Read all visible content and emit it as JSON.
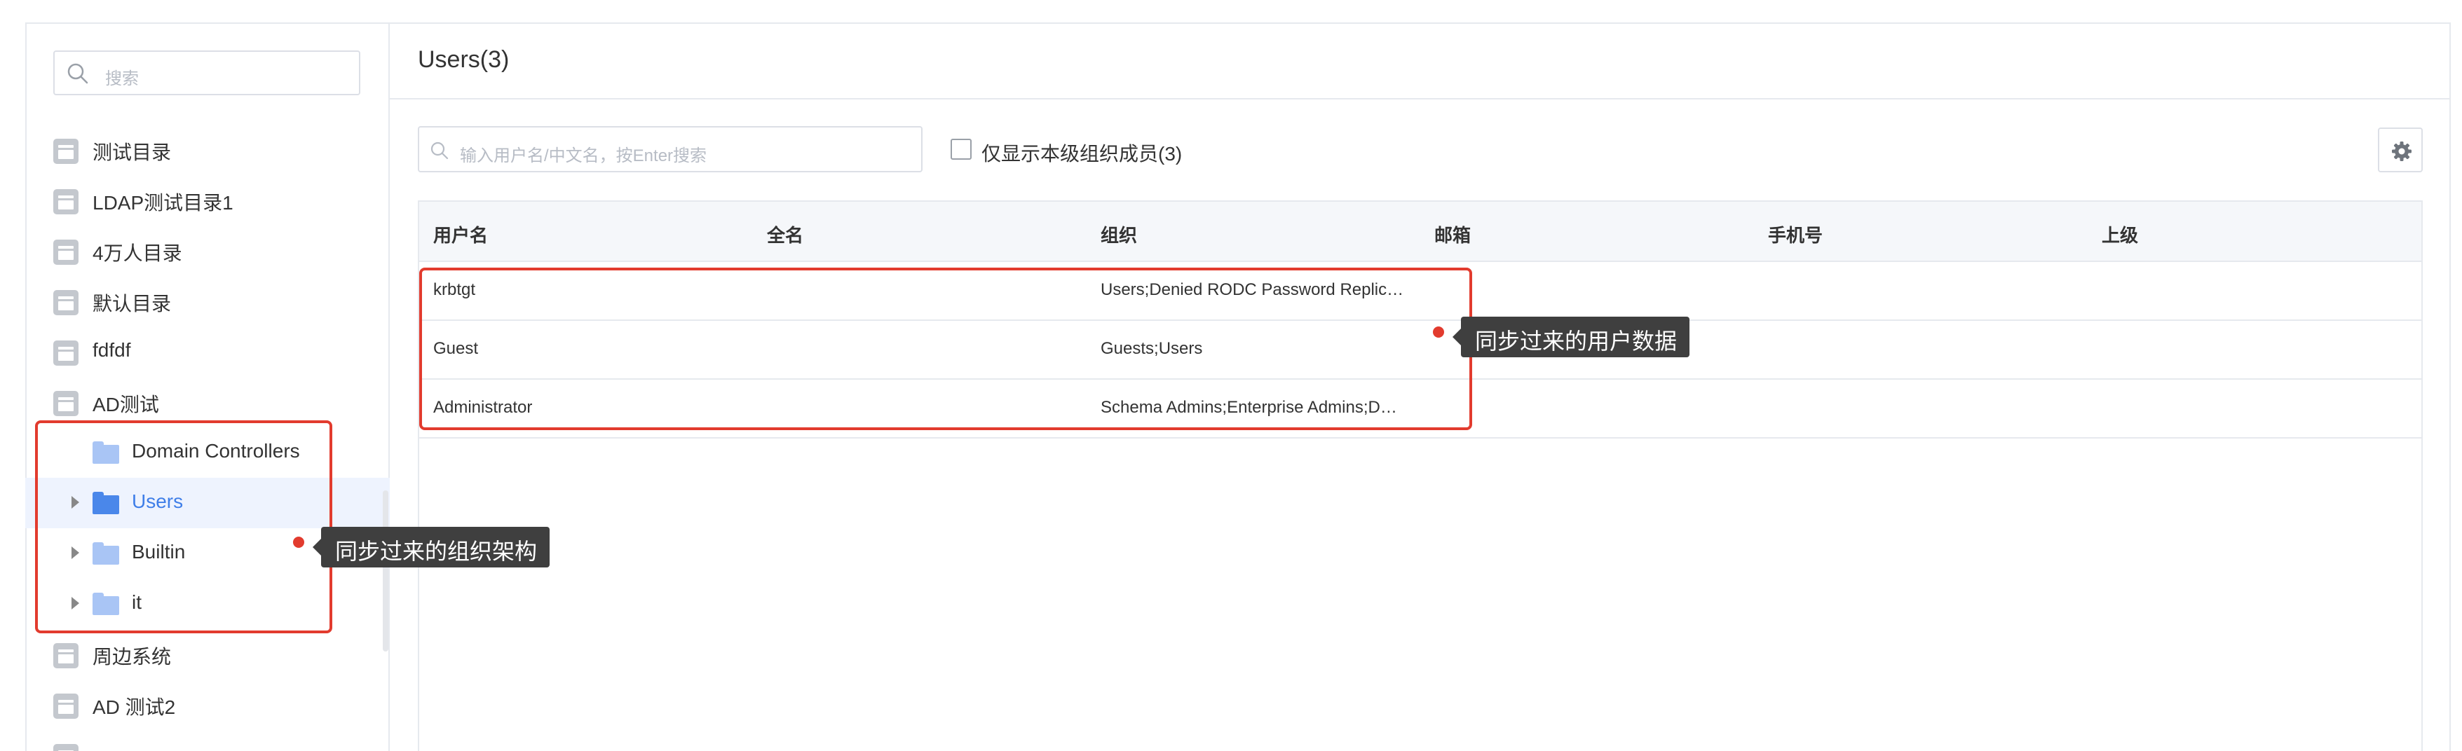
{
  "sidebar": {
    "search_placeholder": "搜索",
    "directories": [
      {
        "label": "测试目录"
      },
      {
        "label": "LDAP测试目录1"
      },
      {
        "label": "4万人目录"
      },
      {
        "label": "默认目录"
      },
      {
        "label": "fdfdf"
      },
      {
        "label": "AD测试"
      }
    ],
    "ad_children": [
      {
        "label": "Domain Controllers",
        "expandable": false,
        "selected": false
      },
      {
        "label": "Users",
        "expandable": true,
        "selected": true
      },
      {
        "label": "Builtin",
        "expandable": true,
        "selected": false
      },
      {
        "label": "it",
        "expandable": true,
        "selected": false
      }
    ],
    "more_directories": [
      {
        "label": "周边系统"
      },
      {
        "label": "AD 测试2"
      }
    ]
  },
  "main": {
    "title": "Users(3)",
    "search_placeholder": "输入用户名/中文名，按Enter搜索",
    "filter_checkbox_label": "仅显示本级组织成员(3)",
    "filter_checked": false,
    "settings_icon": "gear-icon",
    "table": {
      "columns": [
        "用户名",
        "全名",
        "组织",
        "邮箱",
        "手机号",
        "上级"
      ],
      "rows": [
        {
          "username": "krbtgt",
          "fullname": "",
          "org": "Users;Denied RODC Password Replic…",
          "email": "",
          "phone": "",
          "manager": ""
        },
        {
          "username": "Guest",
          "fullname": "",
          "org": "Guests;Users",
          "email": "",
          "phone": "",
          "manager": ""
        },
        {
          "username": "Administrator",
          "fullname": "",
          "org": "Schema Admins;Enterprise Admins;D…",
          "email": "",
          "phone": "",
          "manager": ""
        }
      ]
    }
  },
  "annotations": {
    "org_label": "同步过来的组织架构",
    "users_label": "同步过来的用户数据",
    "color": "#e23b2e"
  },
  "colors": {
    "accent": "#3f7ee8",
    "selected_bg": "#eef3fe",
    "border": "#e6e9ee"
  }
}
